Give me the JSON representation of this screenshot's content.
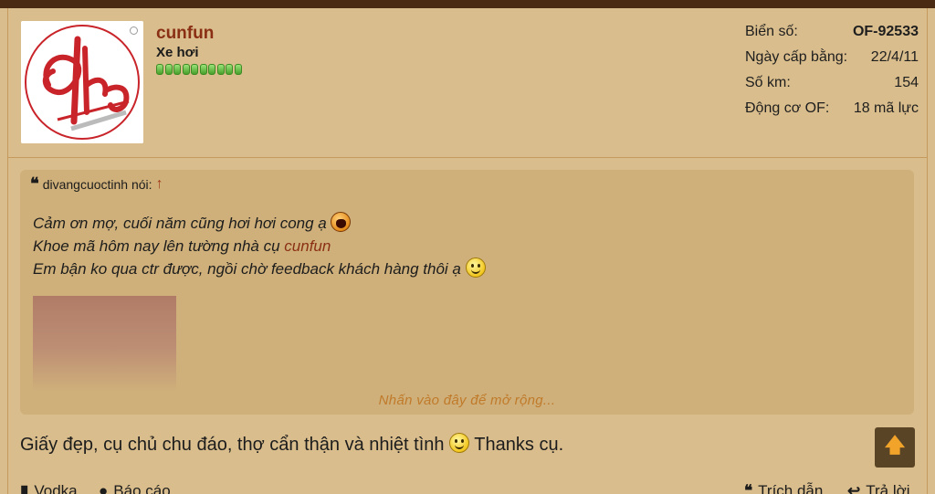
{
  "user": {
    "username": "cunfun",
    "title": "Xe hơi",
    "reputation_pips": 10
  },
  "stats": [
    {
      "label": "Biển số:",
      "value": "OF-92533",
      "bold": true
    },
    {
      "label": "Ngày cấp bằng:",
      "value": "22/4/11",
      "bold": false
    },
    {
      "label": "Số km:",
      "value": "154",
      "bold": false
    },
    {
      "label": "Động cơ OF:",
      "value": "18 mã lực",
      "bold": false
    }
  ],
  "quote": {
    "author_text": "divangcuoctinh nói:",
    "line1": "Cảm ơn mợ, cuối năm cũng hơi hơi cong ạ",
    "line2_prefix": "Khoe mã hôm nay lên tường nhà cụ ",
    "line2_mention": "cunfun",
    "line3": "Em bận ko qua ctr được, ngồi chờ feedback khách hàng thôi ạ",
    "expand_text": "Nhấn vào đây để mở rộng..."
  },
  "message": {
    "before": "Giấy đẹp, cụ chủ chu đáo, thợ cẩn thận và nhiệt tình",
    "after": " Thanks cụ."
  },
  "footer": {
    "vodka_label": "Vodka",
    "report_label": "Báo cáo",
    "quote_label": "Trích dẫn",
    "reply_label": "Trả lời"
  },
  "colors": {
    "background": "#d9bd8c",
    "quote_bg": "#cfb07a",
    "username": "#8a2f14",
    "topbar": "#4a2a12",
    "scroll_button": "#5a4426"
  }
}
